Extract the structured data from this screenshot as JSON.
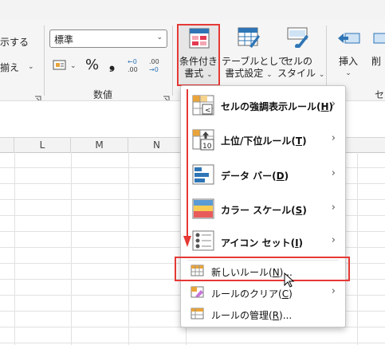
{
  "ribbon": {
    "partial_left_item_1": "示する",
    "partial_left_item_2": "揃え",
    "number_format_value": "標準",
    "number_group_label": "数値",
    "percent_symbol": "%",
    "comma_symbol": "❟",
    "conditional_format": {
      "line1": "条件付き",
      "line2": "書式"
    },
    "table_format": {
      "line1": "テーブルとして",
      "line2": "書式設定"
    },
    "cell_style": {
      "line1": "セルの",
      "line2": "スタイル"
    },
    "insert": {
      "line1": "挿入"
    },
    "delete": {
      "line1": "削"
    },
    "partial_group_label_right": "セ"
  },
  "columns": [
    "L",
    "M",
    "N"
  ],
  "menu": {
    "items": [
      {
        "label": "セルの強調表示ルール(",
        "key": "H",
        "tail": ")",
        "has_submenu": true
      },
      {
        "label": "上位/下位ルール(",
        "key": "T",
        "tail": ")",
        "has_submenu": true
      },
      {
        "label": "データ バー(",
        "key": "D",
        "tail": ")",
        "has_submenu": true
      },
      {
        "label": "カラー スケール(",
        "key": "S",
        "tail": ")",
        "has_submenu": true
      },
      {
        "label": "アイコン セット(",
        "key": "I",
        "tail": ")",
        "has_submenu": true
      }
    ],
    "small_items": [
      {
        "label": "新しいルール(",
        "key": "N",
        "tail": ")...",
        "has_submenu": false
      },
      {
        "label": "ルールのクリア(",
        "key": "C",
        "tail": ")",
        "has_submenu": true
      },
      {
        "label": "ルールの管理(",
        "key": "R",
        "tail": ")...",
        "has_submenu": false
      }
    ],
    "submenu_arrow": "›",
    "icon_top10_text": "10"
  },
  "colors": {
    "highlight_red": "#e53935",
    "ribbon_bg": "#f5f5f5",
    "accent_blue": "#2e75b6"
  }
}
